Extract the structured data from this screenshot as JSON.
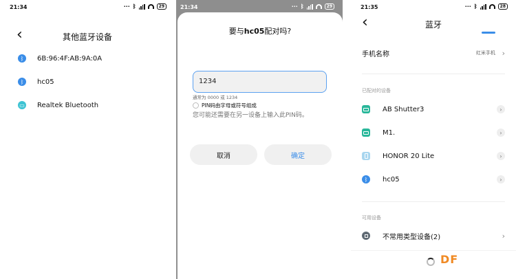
{
  "panel1": {
    "time": "21:34",
    "battery": "29",
    "title": "其他蓝牙设备",
    "devices": [
      {
        "name": "6B:96:4F:AB:9A:0A",
        "icon": "bluetooth-icon"
      },
      {
        "name": "hc05",
        "icon": "bluetooth-icon"
      },
      {
        "name": "Realtek Bluetooth",
        "icon": "monitor-icon"
      }
    ]
  },
  "panel2": {
    "time": "21:34",
    "battery": "29",
    "title_prefix": "要与",
    "title_device": "hc05",
    "title_suffix": "配对吗?",
    "pin_value": "1234",
    "pin_hint": "通常为 0000 或 1234",
    "checkbox_label": "PIN码由字母或符号组成",
    "note": "您可能还需要在另一设备上输入此PIN码。",
    "cancel_label": "取消",
    "ok_label": "确定"
  },
  "panel3": {
    "time": "21:35",
    "battery": "28",
    "title": "蓝牙",
    "phone_name_label": "手机名称",
    "phone_name_value": "红米手机",
    "paired_section": "已配对的设备",
    "paired": [
      {
        "name": "AB Shutter3",
        "icon": "keyboard-icon"
      },
      {
        "name": "M1.",
        "icon": "keyboard-icon"
      },
      {
        "name": "HONOR 20 Lite",
        "icon": "phone-icon"
      },
      {
        "name": "hc05",
        "icon": "bluetooth-icon"
      }
    ],
    "available_section": "可用设备",
    "uncommon_label": "不常用类型设备(2)"
  },
  "watermark": "DF",
  "colors": {
    "accent": "#3a8de8",
    "teal": "#3ec3d3",
    "green": "#29b79a",
    "watermark": "#f08a24"
  }
}
